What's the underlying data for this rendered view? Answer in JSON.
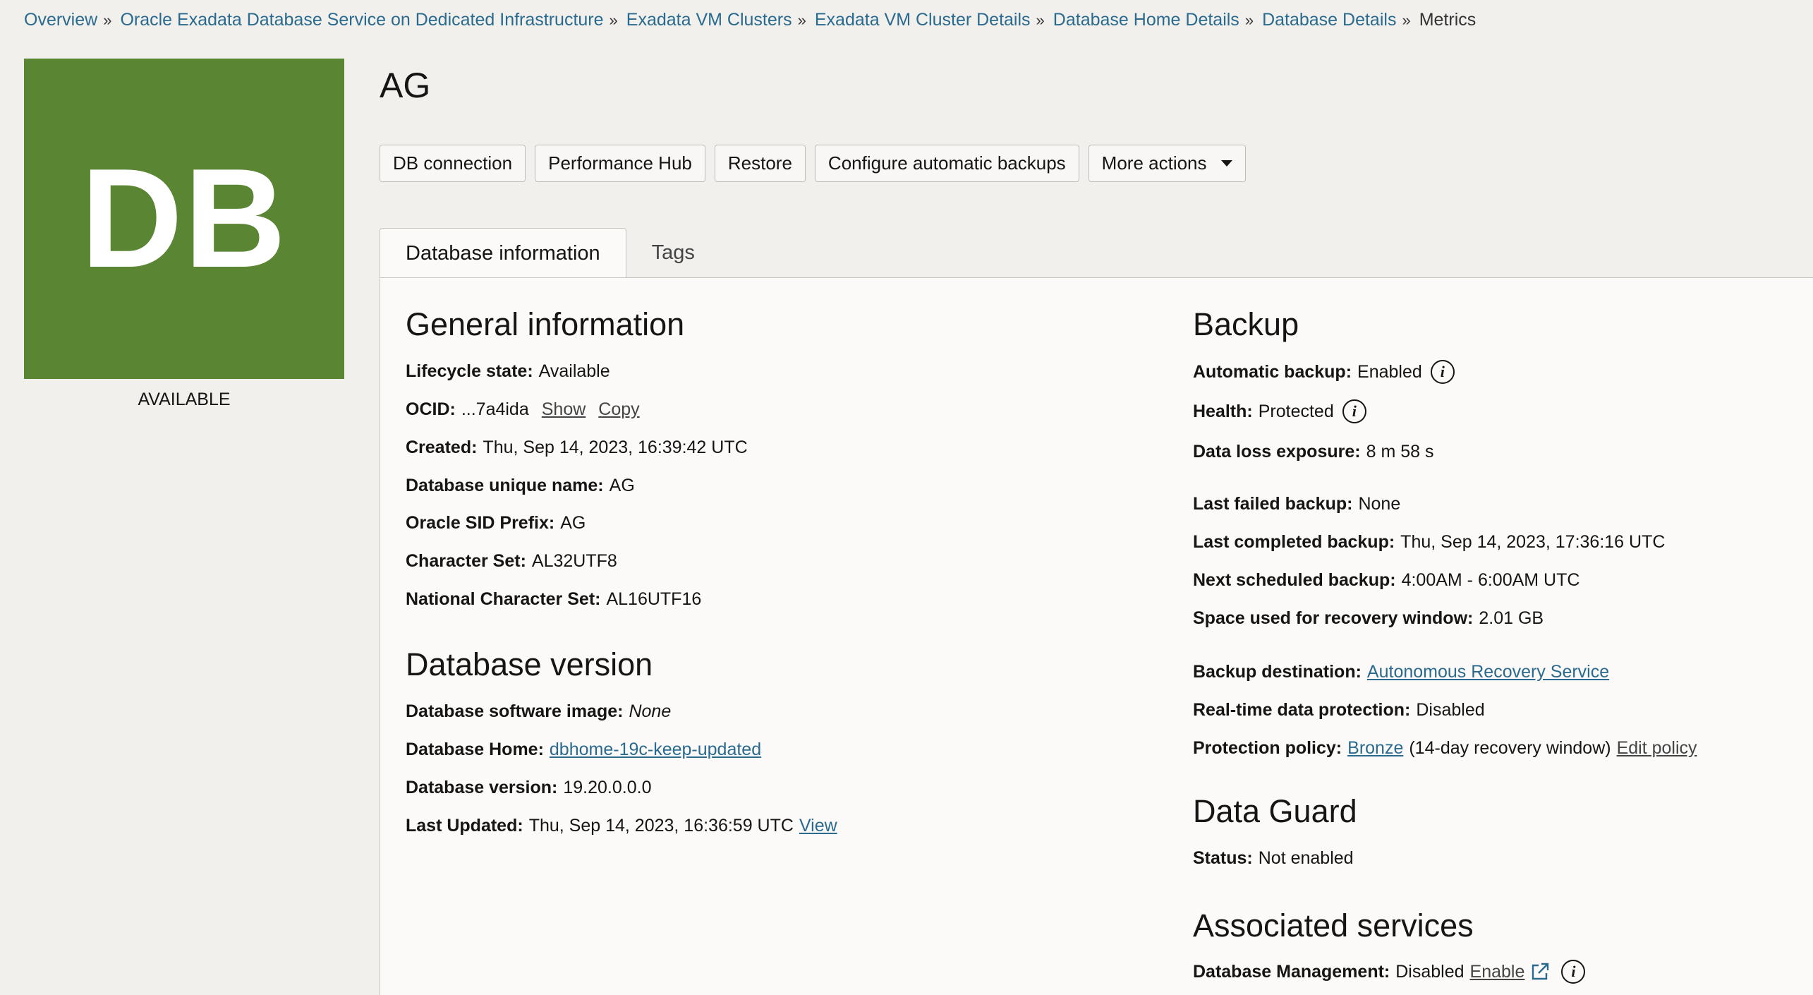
{
  "breadcrumb": {
    "items": [
      "Overview",
      "Oracle Exadata Database Service on Dedicated Infrastructure",
      "Exadata VM Clusters",
      "Exadata VM Cluster Details",
      "Database Home Details",
      "Database Details"
    ],
    "current": "Metrics"
  },
  "tile": {
    "text": "DB",
    "color": "#5a8533",
    "status": "AVAILABLE"
  },
  "title": "AG",
  "actions": {
    "db_connection": "DB connection",
    "performance_hub": "Performance Hub",
    "restore": "Restore",
    "configure_backups": "Configure automatic backups",
    "more_actions": "More actions"
  },
  "tabs": {
    "info": "Database information",
    "tags": "Tags"
  },
  "general": {
    "heading": "General information",
    "lifecycle_label": "Lifecycle state:",
    "lifecycle_value": "Available",
    "ocid_label": "OCID:",
    "ocid_value": "...7a4ida",
    "ocid_show": "Show",
    "ocid_copy": "Copy",
    "created_label": "Created:",
    "created_value": "Thu, Sep 14, 2023, 16:39:42 UTC",
    "unique_name_label": "Database unique name:",
    "unique_name_value": "AG",
    "sid_label": "Oracle SID Prefix:",
    "sid_value": "AG",
    "charset_label": "Character Set:",
    "charset_value": "AL32UTF8",
    "ncharset_label": "National Character Set:",
    "ncharset_value": "AL16UTF16"
  },
  "version": {
    "heading": "Database version",
    "image_label": "Database software image:",
    "image_value": "None",
    "home_label": "Database Home:",
    "home_value": "dbhome-19c-keep-updated",
    "version_label": "Database version:",
    "version_value": "19.20.0.0.0",
    "updated_label": "Last Updated:",
    "updated_value": "Thu, Sep 14, 2023, 16:36:59 UTC",
    "updated_view": "View"
  },
  "backup": {
    "heading": "Backup",
    "auto_label": "Automatic backup:",
    "auto_value": "Enabled",
    "health_label": "Health:",
    "health_value": "Protected",
    "loss_label": "Data loss exposure:",
    "loss_value": "8 m 58 s",
    "failed_label": "Last failed backup:",
    "failed_value": "None",
    "completed_label": "Last completed backup:",
    "completed_value": "Thu, Sep 14, 2023, 17:36:16 UTC",
    "next_label": "Next scheduled backup:",
    "next_value": "4:00AM - 6:00AM UTC",
    "space_label": "Space used for recovery window:",
    "space_value": "2.01 GB",
    "dest_label": "Backup destination:",
    "dest_value": "Autonomous Recovery Service",
    "realtime_label": "Real-time data protection:",
    "realtime_value": "Disabled",
    "policy_label": "Protection policy:",
    "policy_value": "Bronze",
    "policy_note": "(14-day recovery window)",
    "policy_edit": "Edit policy"
  },
  "dataguard": {
    "heading": "Data Guard",
    "status_label": "Status:",
    "status_value": "Not enabled"
  },
  "associated": {
    "heading": "Associated services",
    "dbm_label": "Database Management:",
    "dbm_value": "Disabled",
    "dbm_enable": "Enable"
  }
}
